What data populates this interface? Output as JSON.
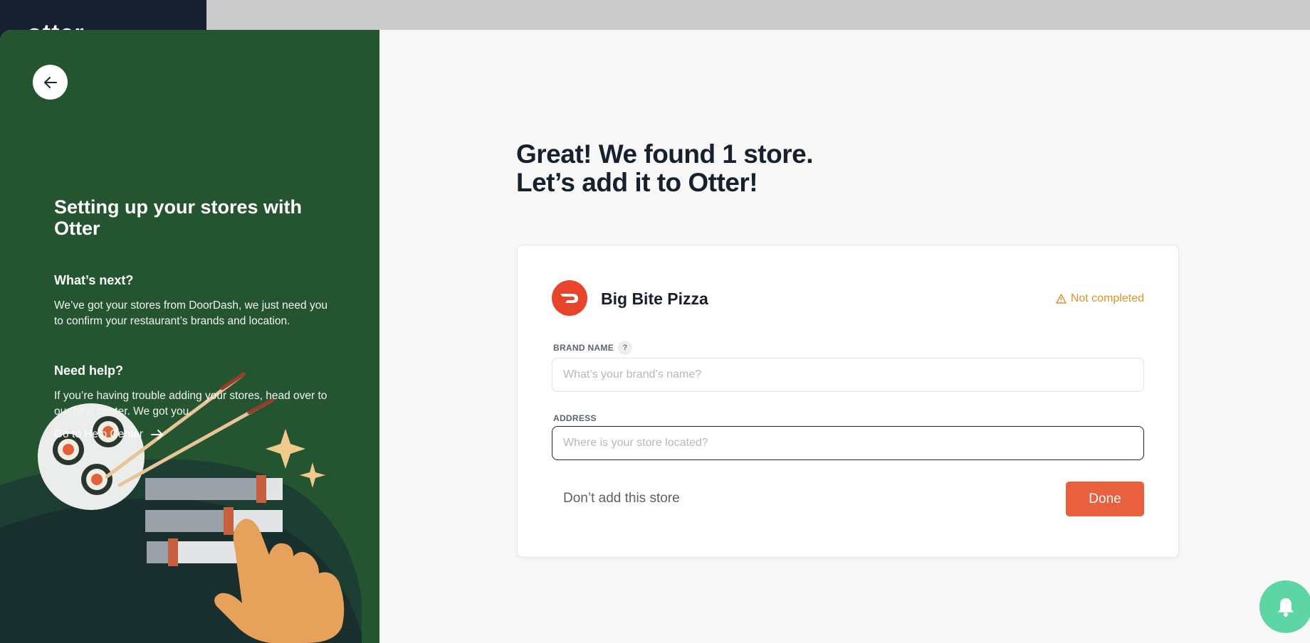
{
  "app": {
    "logo_text": "otter"
  },
  "left_panel": {
    "title": "Setting up your stores with Otter",
    "whats_next_heading": "What’s next?",
    "whats_next_text": "We’ve got your stores from DoorDash, we just need you to confirm your restaurant’s brands and location.",
    "need_help_heading": "Need help?",
    "need_help_text": "If you’re having trouble adding your stores, head over to our help center. We got you.",
    "help_link_label": "Go to Help Center"
  },
  "main": {
    "heading_line1": "Great! We found 1 store.",
    "heading_line2": "Let’s add it to Otter!"
  },
  "store_card": {
    "store_name": "Big Bite Pizza",
    "status_text": "Not completed",
    "brand_name_label": "BRAND NAME",
    "brand_name_help": "?",
    "brand_name_value": "",
    "brand_name_placeholder": "What’s your brand’s name?",
    "address_label": "ADDRESS",
    "address_value": "",
    "address_placeholder": "Where is your store located?",
    "skip_label": "Don’t add this store",
    "done_label": "Done"
  },
  "colors": {
    "left_panel_bg": "#245430",
    "accent": "#e8603e",
    "doordash_red": "#e8442c",
    "warning": "#e0922a",
    "bell_bg": "#5ed6a4"
  },
  "icons": [
    "arrow-left-icon",
    "doordash-icon",
    "warning-icon",
    "arrow-right-icon",
    "bell-icon"
  ]
}
